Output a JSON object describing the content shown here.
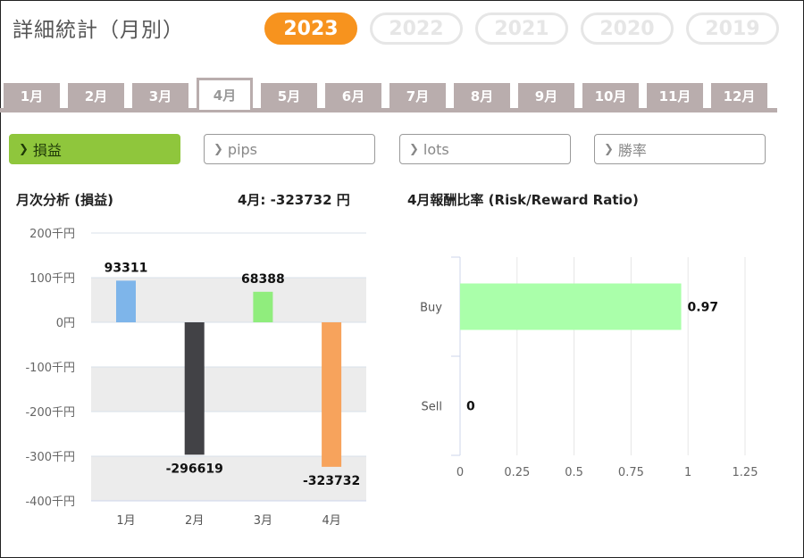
{
  "title": "詳細統計（月別）",
  "years": [
    "2023",
    "2022",
    "2021",
    "2020",
    "2019"
  ],
  "months": [
    "1月",
    "2月",
    "3月",
    "4月",
    "5月",
    "6月",
    "7月",
    "8月",
    "9月",
    "10月",
    "11月",
    "12月"
  ],
  "metrics": [
    "損益",
    "pips",
    "lots",
    "勝率"
  ],
  "left_panel": {
    "title": "月次分析 (損益)",
    "summary": "4月: -323732 円"
  },
  "right_panel": {
    "title": "4月報酬比率 (Risk/Reward Ratio)"
  },
  "icons": {
    "metric_chevron": "chevron-right-icon"
  },
  "colors": {
    "accent": "#f7931e",
    "active_metric": "#8fc63c",
    "tab": "#b9adad"
  },
  "chart_data": [
    {
      "type": "bar",
      "categories": [
        "1月",
        "2月",
        "3月",
        "4月"
      ],
      "values": [
        93311,
        -296619,
        68388,
        -323732
      ],
      "value_labels": [
        "93311",
        "-296619",
        "68388",
        "-323732"
      ],
      "colors": [
        "#7eb5ea",
        "#424246",
        "#90ed7d",
        "#f7a35c"
      ],
      "yticks": [
        "200千円",
        "100千円",
        "0円",
        "-100千円",
        "-200千円",
        "-300千円",
        "-400千円"
      ],
      "ylim": [
        -400000,
        200000
      ],
      "grid": true
    },
    {
      "type": "bar",
      "orientation": "horizontal",
      "categories": [
        "Buy",
        "Sell"
      ],
      "values": [
        0.97,
        0
      ],
      "value_labels": [
        "0.97",
        "0"
      ],
      "color": "#aaffaa",
      "xticks": [
        "0",
        "0.25",
        "0.5",
        "0.75",
        "1",
        "1.25"
      ],
      "xlim": [
        0,
        1.25
      ],
      "grid": true
    }
  ]
}
